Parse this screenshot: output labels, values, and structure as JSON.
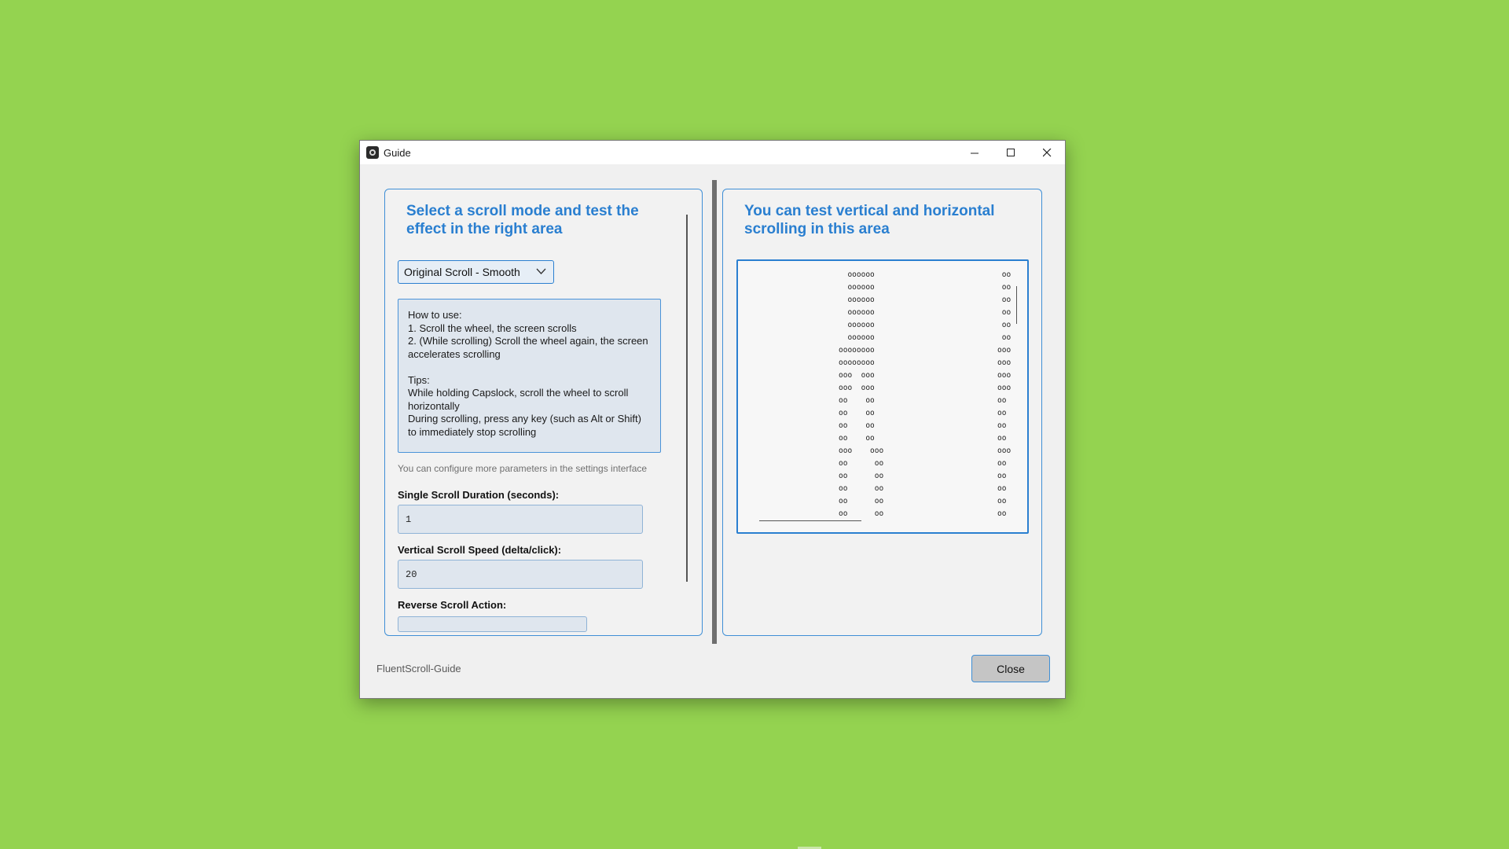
{
  "window": {
    "title": "Guide",
    "footer_label": "FluentScroll-Guide",
    "close_label": "Close"
  },
  "left": {
    "heading": "Select a scroll mode and test the effect in the right area",
    "mode_selected": "Original Scroll - Smooth",
    "info": [
      "How to use:",
      "1. Scroll the wheel, the screen scrolls",
      "2. (While scrolling) Scroll the wheel again, the screen accelerates scrolling",
      "",
      "Tips:",
      "While holding Capslock, scroll the wheel to scroll horizontally",
      "During scrolling, press any key (such as Alt or Shift) to immediately stop scrolling"
    ],
    "note": "You can configure more parameters in the settings interface",
    "duration_label": "Single Scroll Duration (seconds):",
    "duration_value": "1",
    "speed_label": "Vertical Scroll Speed (delta/click):",
    "speed_value": "20",
    "reverse_label": "Reverse Scroll Action:"
  },
  "right": {
    "heading": "You can test vertical and horizontal scrolling in this area",
    "art_left": "  oooooo\n  oooooo\n  oooooo\n  oooooo\n  oooooo\n  oooooo\noooooooo\noooooooo\nooo  ooo\nooo  ooo\noo    oo\noo    oo\noo    oo\noo    oo\nooo    ooo\noo      oo\noo      oo\noo      oo\noo      oo\noo      oo",
    "art_right": " oo\n oo\n oo\n oo\n oo\n oo\nooo\nooo\nooo\nooo\noo\noo\noo\noo\nooo\noo\noo\noo\noo\noo"
  }
}
